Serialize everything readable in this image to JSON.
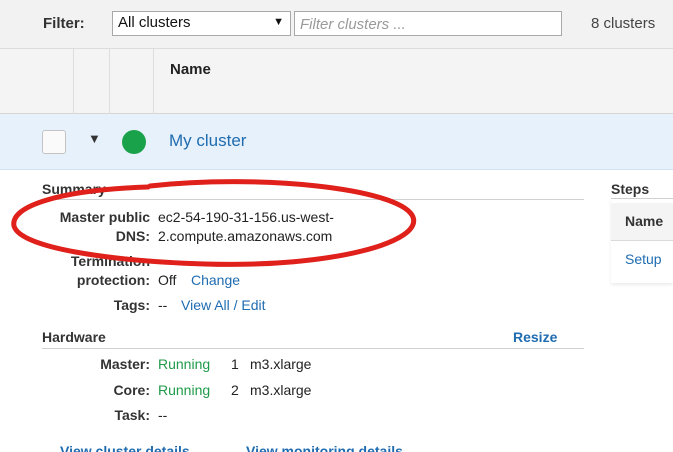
{
  "filter": {
    "label": "Filter:",
    "select_value": "All clusters",
    "search_placeholder": "Filter clusters ...",
    "count": "8 clusters"
  },
  "table": {
    "name_header": "Name"
  },
  "cluster": {
    "name": "My cluster",
    "status_color": "#1aa24a"
  },
  "summary": {
    "title": "Summary",
    "master_dns_label_1": "Master public",
    "master_dns_label_2": "DNS:",
    "master_dns_value_1": "ec2-54-190-31-156.us-west-",
    "master_dns_value_2": "2.compute.amazonaws.com",
    "termination_label_1": "Termination",
    "termination_label_2": "protection:",
    "termination_value": "Off",
    "termination_link": "Change",
    "tags_label": "Tags:",
    "tags_value": "--",
    "tags_link": "View All / Edit"
  },
  "hardware": {
    "title": "Hardware",
    "resize_link": "Resize",
    "master_label": "Master:",
    "master_status": "Running",
    "master_count": "1",
    "master_type": "m3.xlarge",
    "core_label": "Core:",
    "core_status": "Running",
    "core_count": "2",
    "core_type": "m3.xlarge",
    "task_label": "Task:",
    "task_value": "--"
  },
  "footer_links": {
    "cluster_details": "View cluster details",
    "monitoring_details": "View monitoring details"
  },
  "steps": {
    "title": "Steps",
    "name_header": "Name",
    "first_row": "Setup"
  },
  "annotation": {
    "color": "#e0201b"
  }
}
